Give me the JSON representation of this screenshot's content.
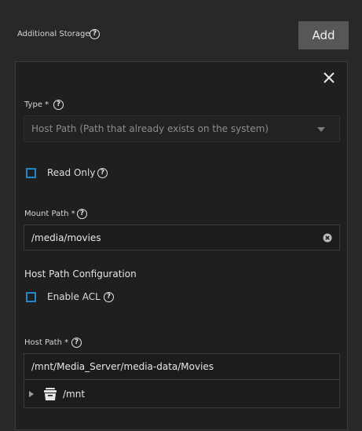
{
  "header": {
    "title": "Additional Storage",
    "add_label": "Add"
  },
  "form": {
    "type_label": "Type *",
    "type_value": "Host Path (Path that already exists on the system)",
    "read_only_label": "Read Only",
    "mount_path_label": "Mount Path *",
    "mount_path_value": "/media/movies",
    "host_path_config_title": "Host Path Configuration",
    "enable_acl_label": "Enable ACL",
    "host_path_label": "Host Path *",
    "host_path_value": "/mnt/Media_Server/media-data/Movies",
    "tree_root_label": "/mnt"
  },
  "icons": {
    "help": "help-circle-icon",
    "close": "close-icon",
    "dropdown": "triangle-down-icon",
    "clear": "clear-circle-icon",
    "expand": "triangle-right-icon",
    "dataset": "dataset-icon"
  },
  "colors": {
    "accent": "#1e88c8",
    "background": "#282828",
    "card": "#1f1f1f"
  }
}
